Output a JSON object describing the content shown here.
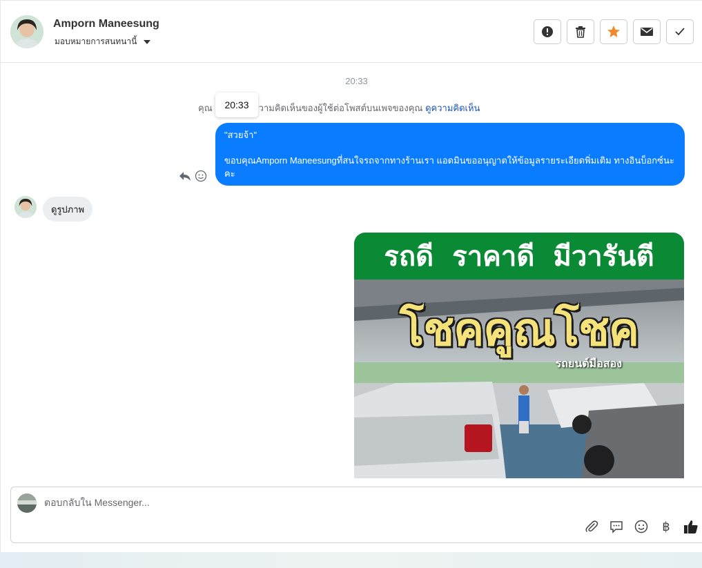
{
  "header": {
    "contact_name": "Amporn Maneesung",
    "assign_label": "มอบหมายการสนทนานี้"
  },
  "conversation": {
    "timestamp": "20:33",
    "system_prefix": "คุณ",
    "system_text": "ลับความคิดเห็นของผู้ใช้ต่อโพสต์บนเพจของคุณ",
    "view_comment_link": "ดูความคิดเห็น",
    "tooltip_time": "20:33",
    "outgoing": {
      "quote": "\"สวยจ้า\"",
      "body": "ขอบคุณAmporn Maneesungที่สนใจรถจากทางร้านเรา แอดมินขออนุญาตให้ข้อมูลรายระเอียดพิ่มเติม ทางอินบ็อกซ์นะคะ"
    },
    "incoming_text": "ดูรูปภาพ",
    "image": {
      "banner_text": "รถดี ราคาดี มีวารันตี",
      "title": "โชคคูณโชค",
      "subtitle": "รถยนต์มือสอง"
    }
  },
  "composer": {
    "placeholder": "ตอบกลับใน Messenger...",
    "baht_symbol": "฿"
  },
  "colors": {
    "outgoing_bubble": "#0a7cff",
    "banner_green": "#0b8a35",
    "star": "#f0892a",
    "link": "#1b57b5"
  },
  "icons": [
    "alert-icon",
    "trash-icon",
    "star-icon",
    "mail-icon",
    "check-icon",
    "reply-icon",
    "emoji-icon",
    "paperclip-icon",
    "saved-reply-icon",
    "baht-icon",
    "thumbs-up-icon"
  ]
}
